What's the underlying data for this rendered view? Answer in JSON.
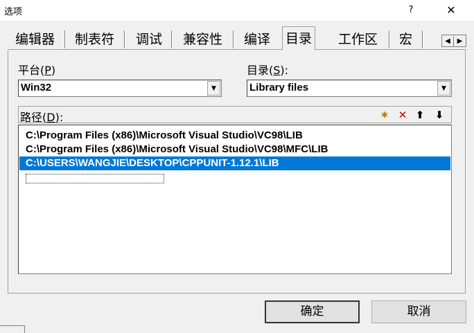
{
  "window": {
    "title": "选项",
    "help": "?",
    "close": "✕"
  },
  "tabs": [
    "编辑器",
    "制表符",
    "调试",
    "兼容性",
    "编译",
    "目录",
    "工作区",
    "宏"
  ],
  "tab_scroll": {
    "left": "◀",
    "right": "▶"
  },
  "platform": {
    "label": "平台",
    "mnemonic": "P",
    "value": "Win32"
  },
  "directory": {
    "label": "目录",
    "mnemonic": "S",
    "value": "Library files"
  },
  "paths": {
    "label": "路径",
    "mnemonic": "D",
    "toolbar": {
      "new": "✱",
      "delete": "✕",
      "up": "⬆",
      "down": "⬇"
    },
    "items": [
      "C:\\Program Files (x86)\\Microsoft Visual Studio\\VC98\\LIB",
      "C:\\Program Files (x86)\\Microsoft Visual Studio\\VC98\\MFC\\LIB",
      "C:\\USERS\\WANGJIE\\DESKTOP\\CPPUNIT-1.12.1\\LIB"
    ]
  },
  "buttons": {
    "ok": "确定",
    "cancel": "取消"
  }
}
